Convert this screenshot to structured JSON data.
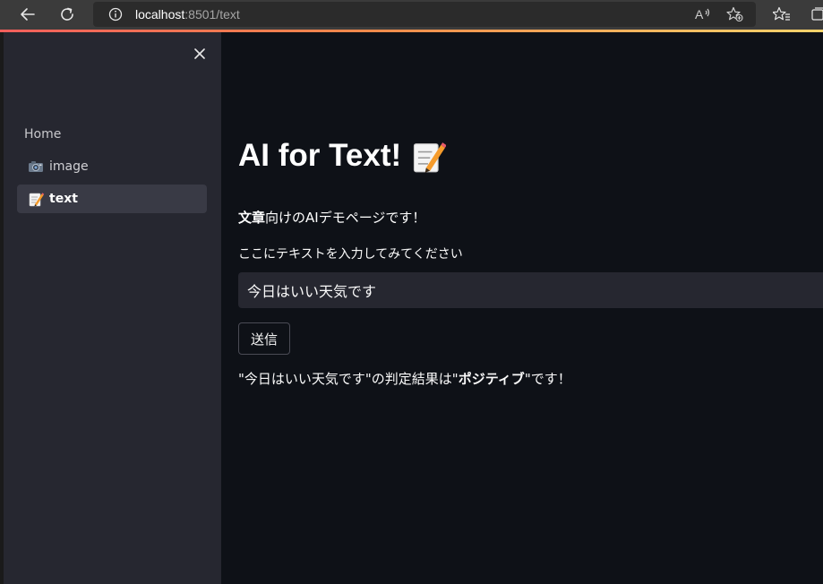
{
  "browser": {
    "url_host": "localhost",
    "url_rest": ":8501/text",
    "accent_colors": [
      "#f25f5c",
      "#f08a4b",
      "#f6d36b"
    ]
  },
  "sidebar": {
    "items": [
      {
        "label": "Home",
        "icon": "home"
      },
      {
        "label": "image",
        "icon": "camera-icon"
      },
      {
        "label": "text",
        "icon": "memo-icon",
        "active": true
      }
    ]
  },
  "main": {
    "title": "AI for Text!",
    "title_icon": "memo-icon",
    "intro_bold": "文章",
    "intro_rest": "向けのAIデモページです！",
    "input_label": "ここにテキストを入力してみてください",
    "input_value": "今日はいい天気です",
    "submit_label": "送信",
    "result_prefix": "\"今日はいい天気です\"の判定結果は\"",
    "result_bold": "ポジティブ",
    "result_suffix": "\"です！"
  }
}
